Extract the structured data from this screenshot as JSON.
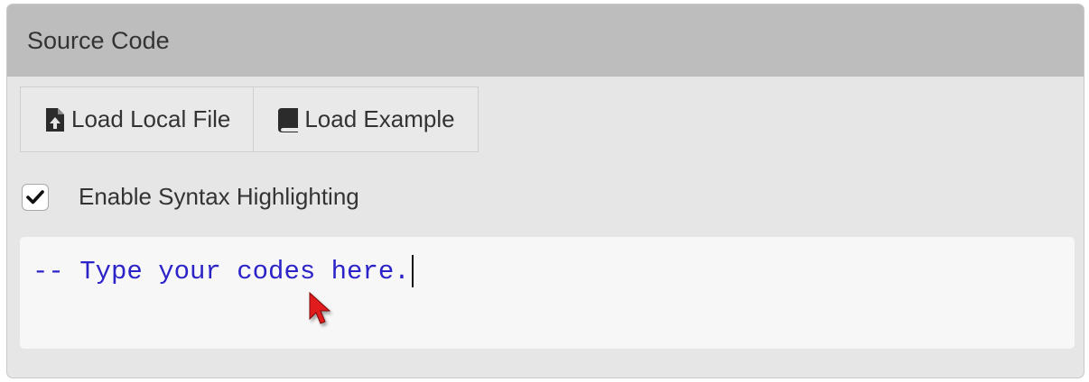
{
  "panel": {
    "title": "Source Code"
  },
  "toolbar": {
    "load_local_label": "Load Local File",
    "load_local_icon": "file-upload-icon",
    "load_example_label": "Load Example",
    "load_example_icon": "book-icon"
  },
  "syntax": {
    "label": "Enable Syntax Highlighting",
    "checked": true
  },
  "editor": {
    "code": "-- Type your codes here."
  },
  "colors": {
    "header_bg": "#bdbdbd",
    "panel_bg": "#e6e6e6",
    "code_text": "#2b22c8",
    "cursor": "#e01a1a"
  }
}
